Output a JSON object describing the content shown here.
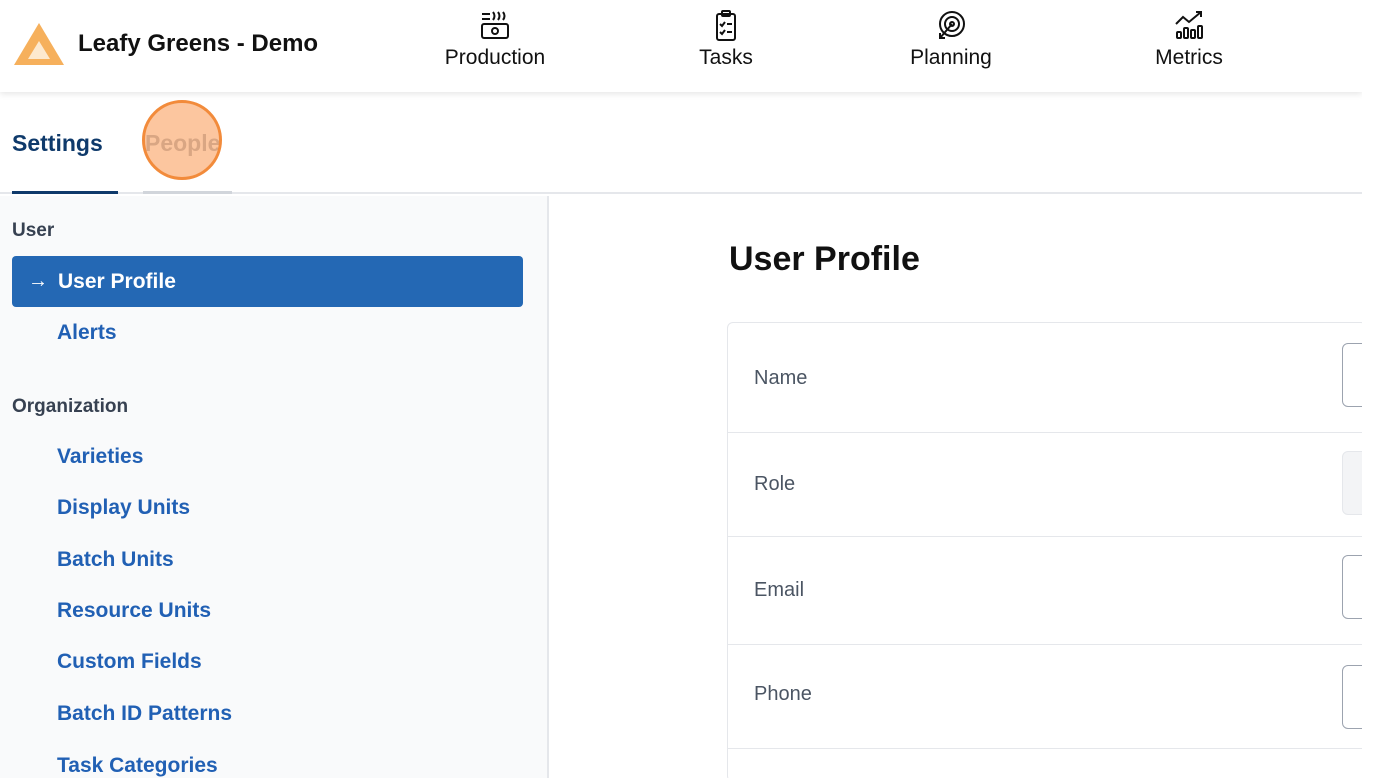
{
  "app": {
    "name": "Leafy Greens - Demo",
    "logo_icon": "triangle-logo-icon",
    "logo_color": "#f6b05c"
  },
  "nav": [
    {
      "label": "Production",
      "icon": "production-icon"
    },
    {
      "label": "Tasks",
      "icon": "clipboard-icon"
    },
    {
      "label": "Planning",
      "icon": "target-icon"
    },
    {
      "label": "Metrics",
      "icon": "chart-icon"
    }
  ],
  "tabs": {
    "settings": "Settings",
    "people": "People"
  },
  "sidebar": {
    "user_section": "User",
    "user_items": [
      "User Profile",
      "Alerts"
    ],
    "active_arrow": "→",
    "org_section": "Organization",
    "org_items": [
      "Varieties",
      "Display Units",
      "Batch Units",
      "Resource Units",
      "Custom Fields",
      "Batch ID Patterns",
      "Task Categories"
    ]
  },
  "main": {
    "title": "User Profile",
    "fields": [
      "Name",
      "Role",
      "Email",
      "Phone"
    ]
  },
  "colors": {
    "primary": "#2468b4",
    "tab_active": "#0f3a6b",
    "link": "#2160b4",
    "click_indicator": "#f28b3b"
  }
}
